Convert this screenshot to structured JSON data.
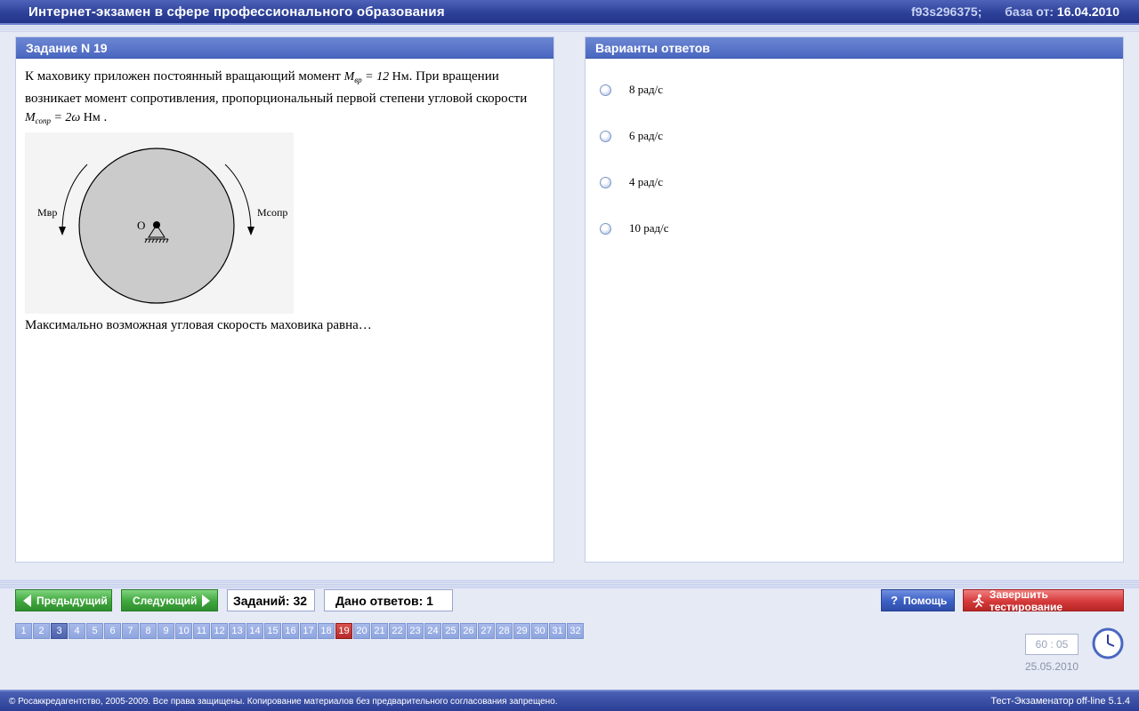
{
  "header": {
    "title": "Интернет-экзамен в сфере профессионального образования",
    "session_code": "f93s296375;",
    "db_label": "база от:",
    "db_date": "16.04.2010"
  },
  "question": {
    "heading": "Задание N 19",
    "text_part1": "К маховику приложен постоянный вращающий момент ",
    "formula1": {
      "symbol": "M",
      "sub": "вр",
      "rhs": " = 12 ",
      "unit": "Нм"
    },
    "text_part2": ". При вращении возникает момент сопротивления, пропорциональный первой степени угловой скорости",
    "formula2": {
      "symbol": "M",
      "sub": "сопр",
      "rhs": " = 2ω ",
      "unit": "Нм"
    },
    "formula2_tail": " .",
    "figure": {
      "label_left": "Mвр",
      "label_right": "Mсопр",
      "center_label": "O"
    },
    "prompt": "Максимально возможная угловая скорость маховика равна…"
  },
  "answers": {
    "heading": "Варианты ответов",
    "options": [
      {
        "label": "8 рад/с"
      },
      {
        "label": "6 рад/с"
      },
      {
        "label": "4 рад/с"
      },
      {
        "label": "10 рад/с"
      }
    ]
  },
  "controls": {
    "prev_label": "Предыдущий",
    "next_label": "Следующий",
    "total_label": "Заданий: 32",
    "answered_label": "Дано ответов: 1",
    "help_label": "Помощь",
    "help_icon": "?",
    "finish_label": "Завершить тестирование"
  },
  "pager": {
    "pages": [
      "1",
      "2",
      "3",
      "4",
      "5",
      "6",
      "7",
      "8",
      "9",
      "10",
      "11",
      "12",
      "13",
      "14",
      "15",
      "16",
      "17",
      "18",
      "19",
      "20",
      "21",
      "22",
      "23",
      "24",
      "25",
      "26",
      "27",
      "28",
      "29",
      "30",
      "31",
      "32"
    ],
    "visited": 3,
    "current": 19
  },
  "timer": {
    "value": "60 : 05",
    "date": "25.05.2010"
  },
  "footer": {
    "copyright": "© Росаккредагентство, 2005-2009. Все права защищены. Копирование материалов без предварительного согласования запрещено.",
    "version": "Тест-Экзаменатор off-line 5.1.4"
  },
  "colors": {
    "title_bar": "#2c3f98",
    "panel_head": "#4a67c1",
    "nav_green": "#3fa63d",
    "finish_red": "#d53a3a",
    "current_page": "#b52a2a"
  },
  "icons": {
    "prev": "triangle-left-icon",
    "next": "triangle-right-icon",
    "help": "question-icon",
    "finish": "running-man-icon",
    "clock": "clock-icon"
  }
}
